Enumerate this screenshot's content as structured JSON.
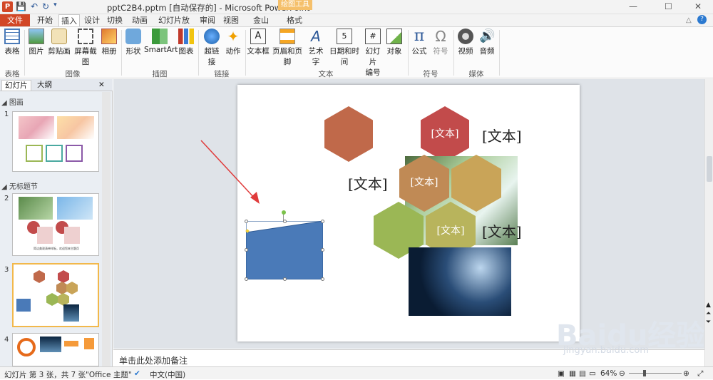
{
  "titlebar": {
    "app_icon": "P",
    "title": "pptC2B4.pptm [自动保存的] - Microsoft PowerPoint",
    "contextual_group": "绘图工具",
    "win_buttons": [
      "—",
      "☐",
      "✕"
    ]
  },
  "tabs": {
    "file": "文件",
    "home": "开始",
    "insert": "插入",
    "design": "设计",
    "transitions": "切换",
    "animations": "动画",
    "slideshow": "幻灯片放映",
    "review": "审阅",
    "view": "视图",
    "kingsoft_pdf": "金山PDF",
    "format": "格式"
  },
  "ribbon": {
    "groups": {
      "tables": "表格",
      "images": "图像",
      "illustrations": "插图",
      "links": "链接",
      "text": "文本",
      "symbols": "符号",
      "media": "媒体"
    },
    "buttons": {
      "table": "表格",
      "picture": "图片",
      "clipart": "剪贴画",
      "screenshot": "屏幕截图",
      "album": "相册",
      "shapes": "形状",
      "smartart": "SmartArt",
      "chart": "图表",
      "hyperlink": "超链接",
      "action": "动作",
      "textbox": "文本框",
      "header_footer": "页眉和页脚",
      "wordart": "艺术字",
      "datetime": "日期和时间",
      "slide_number_1": "幻灯片",
      "slide_number_2": "编号",
      "object": "对象",
      "equation": "公式",
      "symbol": "符号",
      "video": "视频",
      "audio": "音频"
    }
  },
  "left_panel": {
    "tab_slides": "幻灯片",
    "tab_outline": "大纲",
    "close": "✕",
    "section1": "◢ 图画",
    "section2": "◢ 无标题节",
    "slide_numbers": [
      "1",
      "2",
      "3",
      "4"
    ],
    "thumb2_caption": "简洁美观清单样板，欢迎您来主题页"
  },
  "slide": {
    "hex_labels": [
      "[文本]",
      "[文本]",
      "[文本]"
    ],
    "text_labels": [
      "[文本]",
      "[文本]",
      "[文本]"
    ],
    "colors": {
      "hex1": "#c0694a",
      "hex2": "#c24b4b",
      "hex3": "#c08a55",
      "hex4": "#c9a458",
      "hex5": "#9bb755",
      "hex6": "#b8b45c",
      "shape": "#4a7ab8"
    }
  },
  "notes_placeholder": "单击此处添加备注",
  "status": {
    "slide_info": "幻灯片 第 3 张，共 7 张",
    "theme": "\"Office 主题\"",
    "language": "中文(中国)",
    "zoom": "64%"
  },
  "watermark": {
    "brand": "Baidu经验",
    "url": "jingyan.baidu.com"
  }
}
